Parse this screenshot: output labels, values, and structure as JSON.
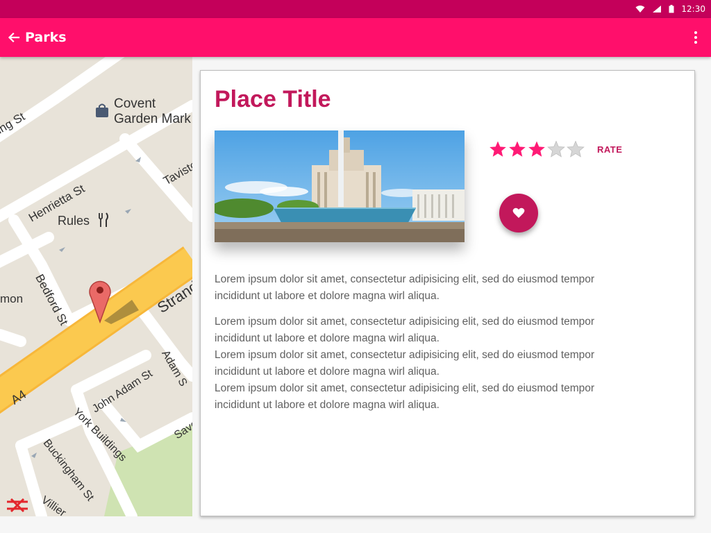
{
  "status_bar": {
    "time": "12:30"
  },
  "app_bar": {
    "title": "Parks"
  },
  "map": {
    "labels": {
      "covent_1": "Covent",
      "covent_2": "Garden Mark",
      "ing_st": "ing St",
      "henrietta": "Henrietta St",
      "tavistock": "Tavisto",
      "rules": "Rules",
      "strand": "Strand",
      "bedford": "Bedford St",
      "mon": "mon",
      "a4": "A4",
      "john_adam": "John Adam St",
      "adam": "Adam S",
      "york": "York Buildings",
      "buckingham": "Buckingham St",
      "savoy": "Savo",
      "villiers": "Villier"
    }
  },
  "place": {
    "title": "Place Title",
    "rating": 3,
    "rating_max": 5,
    "rate_label": "RATE",
    "paragraph_1": "Lorem ipsum dolor sit amet, consectetur adipisicing elit, sed do eiusmod tempor incididunt ut labore et dolore magna wirl aliqua.",
    "paragraph_2": "Lorem ipsum dolor sit amet, consectetur adipisicing elit, sed do eiusmod tempor incididunt ut labore et dolore magna wirl aliqua.",
    "paragraph_3": "Lorem ipsum dolor sit amet, consectetur adipisicing elit, sed do eiusmod tempor incididunt ut labore et dolore magna wirl aliqua.",
    "paragraph_4": "Lorem ipsum dolor sit amet, consectetur adipisicing elit, sed do eiusmod tempor incididunt ut labore et dolore magna wirl aliqua."
  },
  "colors": {
    "status_bar": "#c4005a",
    "app_bar": "#ff0f6b",
    "accent": "#c2185b",
    "star_filled": "#ff1a75",
    "star_empty": "#d6d6d6"
  },
  "icons": [
    "wifi-icon",
    "cell-signal-icon",
    "battery-icon",
    "back-arrow-icon",
    "overflow-menu-icon",
    "map-pin-icon",
    "shopping-bag-icon",
    "restaurant-icon",
    "rail-icon",
    "star-icon",
    "heart-icon"
  ]
}
